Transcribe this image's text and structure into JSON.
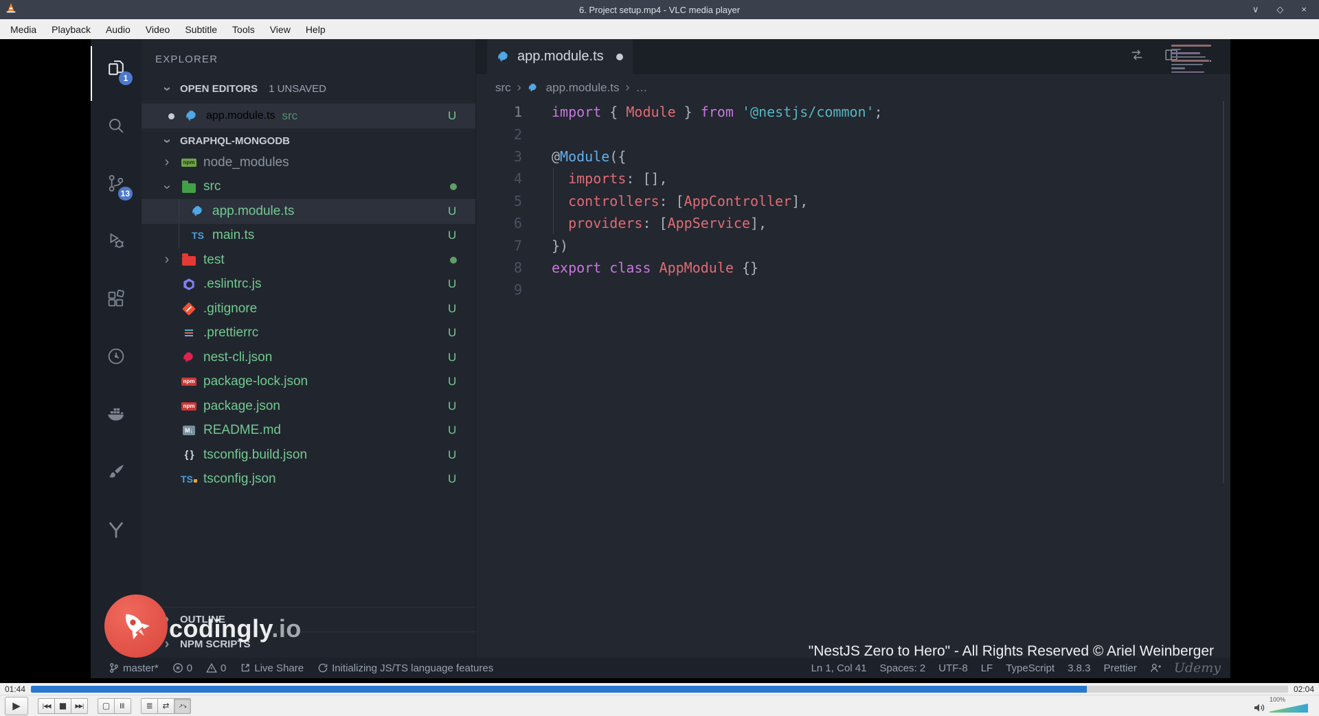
{
  "vlc": {
    "window_title": "6. Project setup.mp4 - VLC media player",
    "window_controls": {
      "minimize": "∨",
      "maximize": "◇",
      "close": "×"
    },
    "menu": [
      "Media",
      "Playback",
      "Audio",
      "Video",
      "Subtitle",
      "Tools",
      "View",
      "Help"
    ],
    "seek": {
      "elapsed": "01:44",
      "total": "02:04",
      "progress_pct": 84
    },
    "controls": [
      {
        "name": "play",
        "glyph": "▶",
        "group": "play"
      },
      {
        "name": "previous",
        "glyph": "|◀◀",
        "group": "b",
        "small": true
      },
      {
        "name": "stop",
        "glyph": "■",
        "group": "b"
      },
      {
        "name": "next",
        "glyph": "▶▶|",
        "group": "b",
        "small": true
      },
      {
        "name": "fullscreen",
        "glyph": "▢",
        "group": "c"
      },
      {
        "name": "extended-settings",
        "glyph": "≡",
        "group": "c",
        "rot": true
      },
      {
        "name": "playlist",
        "glyph": "≣",
        "group": "d"
      },
      {
        "name": "loop",
        "glyph": "⇄",
        "group": "d"
      },
      {
        "name": "random",
        "glyph": "↗↘",
        "group": "d",
        "small": true,
        "active": true
      }
    ],
    "volume": {
      "level_label": "100%"
    }
  },
  "vscode": {
    "activity_bar": {
      "items": [
        {
          "name": "explorer",
          "badge": "1",
          "active": true
        },
        {
          "name": "search"
        },
        {
          "name": "source-control",
          "badge": "13"
        },
        {
          "name": "run-debug"
        },
        {
          "name": "extensions"
        },
        {
          "name": "clock"
        },
        {
          "name": "docker"
        },
        {
          "name": "brush"
        },
        {
          "name": "y-branch"
        }
      ]
    },
    "explorer": {
      "title": "EXPLORER",
      "open_editors": {
        "label": "OPEN EDITORS",
        "badge": "1 UNSAVED",
        "item": {
          "label": "app.module.ts",
          "detail": "src",
          "status": "U"
        }
      },
      "project_label": "GRAPHQL-MONGODB",
      "tree": [
        {
          "label": "node_modules",
          "icon": "npm-folder",
          "indent": 1,
          "chevron": "collapsed",
          "muted": true
        },
        {
          "label": "src",
          "icon": "folder-src",
          "indent": 1,
          "chevron": "expanded",
          "status_dot": true
        },
        {
          "label": "app.module.ts",
          "icon": "nest-module",
          "indent": 2,
          "status": "U",
          "selected": true
        },
        {
          "label": "main.ts",
          "icon": "ts",
          "indent": 2,
          "status": "U"
        },
        {
          "label": "test",
          "icon": "folder-test",
          "indent": 1,
          "chevron": "collapsed",
          "status_dot": true
        },
        {
          "label": ".eslintrc.js",
          "icon": "eslint",
          "indent": 1,
          "status": "U"
        },
        {
          "label": ".gitignore",
          "icon": "git",
          "indent": 1,
          "status": "U"
        },
        {
          "label": ".prettierrc",
          "icon": "prettier",
          "indent": 1,
          "status": "U"
        },
        {
          "label": "nest-cli.json",
          "icon": "nest",
          "indent": 1,
          "status": "U"
        },
        {
          "label": "package-lock.json",
          "icon": "npm",
          "indent": 1,
          "status": "U"
        },
        {
          "label": "package.json",
          "icon": "npm",
          "indent": 1,
          "status": "U"
        },
        {
          "label": "README.md",
          "icon": "markdown",
          "indent": 1,
          "status": "U"
        },
        {
          "label": "tsconfig.build.json",
          "icon": "braces",
          "indent": 1,
          "status": "U"
        },
        {
          "label": "tsconfig.json",
          "icon": "ts-config",
          "indent": 1,
          "status": "U"
        }
      ],
      "bottom_sections": [
        {
          "label": "OUTLINE"
        },
        {
          "label": "NPM SCRIPTS"
        }
      ]
    },
    "editor": {
      "tab": {
        "label": "app.module.ts"
      },
      "breadcrumbs": [
        "src",
        "app.module.ts",
        "…"
      ],
      "code": {
        "lines": [
          {
            "n": 1,
            "toks": [
              [
                "import ",
                "kw"
              ],
              [
                "{ ",
                "pn"
              ],
              [
                "Module",
                "id"
              ],
              [
                " } ",
                "pn"
              ],
              [
                "from ",
                "kw"
              ],
              [
                "'@nestjs/common'",
                "str"
              ],
              [
                ";",
                "pn"
              ]
            ]
          },
          {
            "n": 2,
            "toks": []
          },
          {
            "n": 3,
            "toks": [
              [
                "@",
                "pn"
              ],
              [
                "Module",
                "dec"
              ],
              [
                "({",
                "pn"
              ]
            ]
          },
          {
            "n": 4,
            "guide": true,
            "toks": [
              [
                "  ",
                "pn"
              ],
              [
                "imports",
                "id"
              ],
              [
                ": [],",
                "pn"
              ]
            ]
          },
          {
            "n": 5,
            "guide": true,
            "toks": [
              [
                "  ",
                "pn"
              ],
              [
                "controllers",
                "id"
              ],
              [
                ": [",
                "pn"
              ],
              [
                "AppController",
                "id"
              ],
              [
                "],",
                "pn"
              ]
            ]
          },
          {
            "n": 6,
            "guide": true,
            "toks": [
              [
                "  ",
                "pn"
              ],
              [
                "providers",
                "id"
              ],
              [
                ": [",
                "pn"
              ],
              [
                "AppService",
                "id"
              ],
              [
                "],",
                "pn"
              ]
            ]
          },
          {
            "n": 7,
            "toks": [
              [
                "})",
                "pn"
              ]
            ]
          },
          {
            "n": 8,
            "toks": [
              [
                "export class ",
                "kw"
              ],
              [
                "AppModule",
                "id"
              ],
              [
                " {}",
                "pn"
              ]
            ]
          },
          {
            "n": 9,
            "toks": []
          }
        ]
      }
    },
    "status_bar": {
      "left": [
        {
          "icon": "git-branch",
          "label": "master*"
        },
        {
          "icon": "error-circle",
          "label": "0"
        },
        {
          "icon": "warning-triangle",
          "label": "0"
        },
        {
          "icon": "live-share",
          "label": "Live Share"
        },
        {
          "icon": "sync",
          "label": "Initializing JS/TS language features"
        }
      ],
      "right": [
        {
          "label": "Ln 1, Col 41"
        },
        {
          "label": "Spaces: 2"
        },
        {
          "label": "UTF-8"
        },
        {
          "label": "LF"
        },
        {
          "label": "TypeScript"
        },
        {
          "label": "3.8.3"
        },
        {
          "label": "Prettier"
        },
        {
          "icon": "person-add"
        }
      ],
      "watermark": "Udemy"
    }
  },
  "overlay": {
    "brand": "codingly",
    "brand_tld": ".io",
    "copyright": "\"NestJS Zero to Hero\" - All Rights Reserved © Ariel Weinberger"
  },
  "colors": {
    "badge_blue": "#4d78cc",
    "untracked_green": "#73c991",
    "vlc_seek_blue": "#2a78cd",
    "nest_red": "#e0234e",
    "nest_blue": "#4fa8e8"
  }
}
